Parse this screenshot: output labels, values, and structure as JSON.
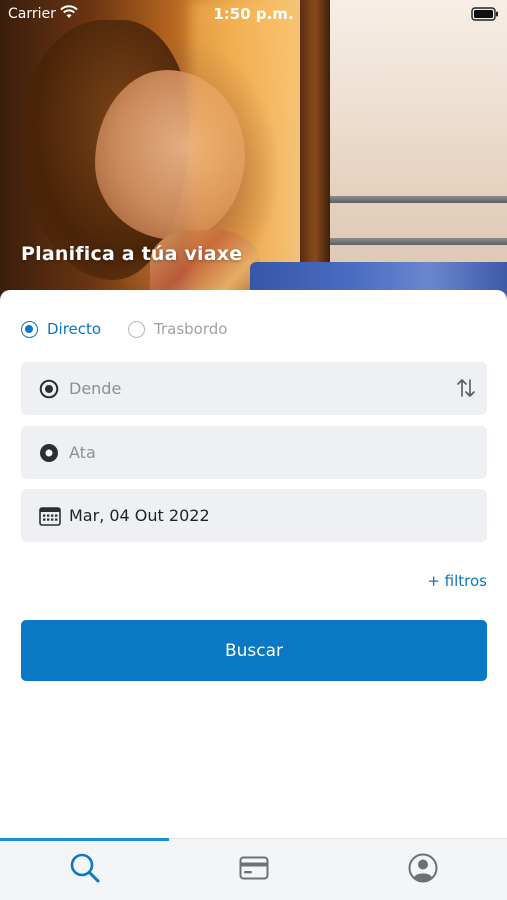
{
  "status_bar": {
    "carrier": "Carrier",
    "time": "1:50 p.m."
  },
  "hero": {
    "title": "Planifica a túa viaxe"
  },
  "trip_type": {
    "options": [
      {
        "label": "Directo",
        "selected": true
      },
      {
        "label": "Trasbordo",
        "selected": false
      }
    ]
  },
  "form": {
    "origin_placeholder": "Dende",
    "destination_placeholder": "Ata",
    "date_value": "Mar, 04 Out 2022"
  },
  "filters_link": "+ filtros",
  "search_button": "Buscar",
  "tab_bar": {
    "tabs": [
      {
        "icon": "search-icon",
        "active": true
      },
      {
        "icon": "card-icon",
        "active": false
      },
      {
        "icon": "profile-icon",
        "active": false
      }
    ]
  },
  "colors": {
    "accent": "#0a78c4",
    "field_bg": "#eef0f4",
    "tab_bar_bg": "#f4f5f7"
  }
}
